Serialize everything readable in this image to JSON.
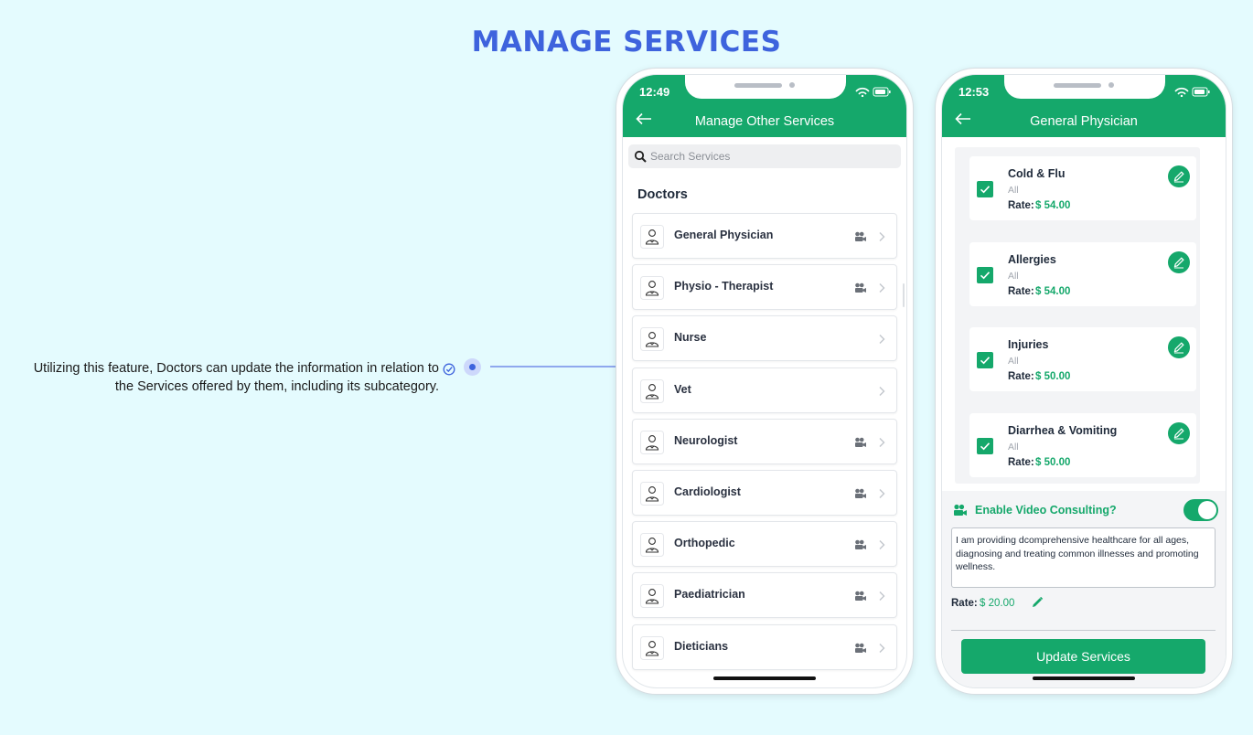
{
  "page": {
    "title": "MANAGE SERVICES"
  },
  "annotation": {
    "line1": "Utilizing this feature, Doctors can update the information in relation to",
    "line2": "the Services offered by them, including its subcategory."
  },
  "phone1": {
    "time": "12:49",
    "header_title": "Manage Other Services",
    "search_placeholder": "Search Services",
    "section_title": "Doctors",
    "services": [
      {
        "label": "General Physician",
        "video": true
      },
      {
        "label": "Physio - Therapist",
        "video": true
      },
      {
        "label": "Nurse",
        "video": false
      },
      {
        "label": "Vet",
        "video": false
      },
      {
        "label": "Neurologist",
        "video": true
      },
      {
        "label": "Cardiologist",
        "video": true
      },
      {
        "label": "Orthopedic",
        "video": true
      },
      {
        "label": "Paediatrician",
        "video": true
      },
      {
        "label": "Dieticians",
        "video": true
      }
    ]
  },
  "phone2": {
    "time": "12:53",
    "header_title": "General Physician",
    "rate_label": "Rate:",
    "subcategories": [
      {
        "name": "Cold & Flu",
        "scope": "All",
        "rate": "$ 54.00",
        "checked": true
      },
      {
        "name": "Allergies",
        "scope": "All",
        "rate": "$ 54.00",
        "checked": true
      },
      {
        "name": "Injuries",
        "scope": "All",
        "rate": "$ 50.00",
        "checked": true
      },
      {
        "name": "Diarrhea & Vomiting",
        "scope": "All",
        "rate": "$ 50.00",
        "checked": true
      }
    ],
    "video_consulting": {
      "label": "Enable Video Consulting?",
      "enabled": true,
      "description": "I am providing dcomprehensive healthcare for all ages, diagnosing and treating common illnesses and promoting wellness.",
      "rate_label": "Rate:",
      "rate": "$ 20.00"
    },
    "update_button": "Update Services"
  },
  "colors": {
    "brand_green": "#15a86b",
    "title_blue": "#3e63dd",
    "background": "#e4fbfe"
  }
}
